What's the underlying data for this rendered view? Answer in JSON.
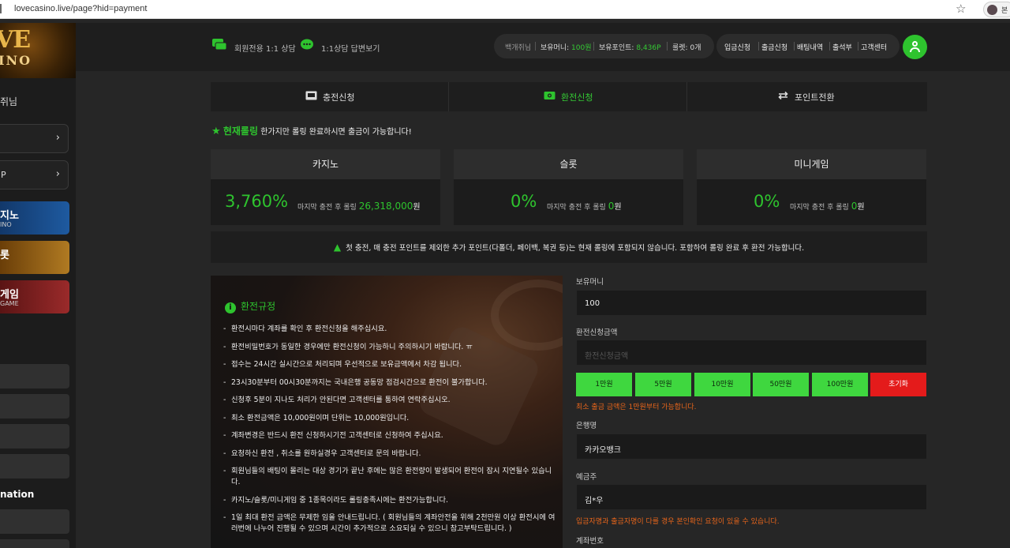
{
  "browser": {
    "url": "lovecasino.live/page?hid=payment",
    "profile_label": "본"
  },
  "logo": {
    "line1": "VE",
    "line2": "INO"
  },
  "sidebar": {
    "user": "쥐님",
    "buttons": [
      {
        "label": ""
      },
      {
        "label": "P"
      }
    ],
    "games": [
      {
        "title": "지노",
        "sub": "INO",
        "color": "#1d4f8a"
      },
      {
        "title": "롯",
        "sub": "",
        "color": "#9a6416"
      },
      {
        "title": "게임",
        "sub": "GAME",
        "color": "#8a2424"
      }
    ],
    "info_label": "nation"
  },
  "topbar": {
    "consult": "회원전용 1:1 상담",
    "answers": "1:1상담 답변보기",
    "stats": {
      "name": "백개쥐님",
      "money_label": "보유머니:",
      "money_value": "100원",
      "point_label": "보유포인트:",
      "point_value": "8,436P",
      "ticket_label": "룰렛:",
      "ticket_value": "0개"
    },
    "menu": [
      "입금신청",
      "출금신청",
      "배팅내역",
      "출석부",
      "고객센터"
    ]
  },
  "tabs": [
    {
      "label": "충전신청",
      "icon": "wallet-icon"
    },
    {
      "label": "환전신청",
      "icon": "cash-icon"
    },
    {
      "label": "포인트전환",
      "icon": "exchange-icon"
    }
  ],
  "rolling": {
    "title": "현재롤링",
    "desc": "한가지만 롤링 완료하시면 출금이 가능합니다!"
  },
  "cards": [
    {
      "title": "카지노",
      "pct": "3,760%",
      "sub": "마지막 충전 후 롤링",
      "amount": "26,318,000",
      "unit": "원"
    },
    {
      "title": "슬롯",
      "pct": "0%",
      "sub": "마지막 충전 후 롤링",
      "amount": "0",
      "unit": "원"
    },
    {
      "title": "미니게임",
      "pct": "0%",
      "sub": "마지막 충전 후 롤링",
      "amount": "0",
      "unit": "원"
    }
  ],
  "notice": "첫 충전, 매 충전 포인트를 제외한 추가 포인트(다폴더, 페이백, 복권 등)는 현재 롤링에 포함되지 않습니다. 포함하여 롤링 완료 후 환전 가능합니다.",
  "rules": {
    "title": "환전규정",
    "items": [
      "환전시마다 계좌를 확인 후 환전신청을 해주십시요.",
      "환전비밀번호가 동일한 경우에만 환전신청이 가능하니 주의하시기 바랍니다. ㅠ",
      "접수는 24시간 실시간으로 처리되며 우선적으로 보유금액에서 차감 됩니다.",
      "23시30분부터 00시30분까지는 국내은행 공동망 점검시간으로 환전이 불가합니다.",
      "신청후 5분이 지나도 처리가 안된다면 고객센터를 통하여 연락주십시오.",
      "최소 환전금액은 10,000원이며 단위는 10,000원입니다.",
      "계좌변경은 반드시 환전 신청하시기전 고객센터로 신청하여 주십시요.",
      "요청하신 환전 , 취소를 원하실경우 고객센터로 문의 바랍니다.",
      "회원님들의 배팅이 몰리는 대상 경기가 끝난 후에는 많은 환전량이 발생되어 환전이 잠시 지연될수 있습니다.",
      "카지노/슬롯/미니게임 중 1종목이라도 롤링충족시에는 환전가능합니다.",
      "1일 최대 환전 금액은 무제한 임을 안내드립니다. ( 회원님들의 계좌안전을 위해 2천만원 이상 환전시에 여러번에 나누어 진행될 수 있으며 시간이 추가적으로 소요되실 수 있으니 참고부탁드립니다. )"
    ]
  },
  "form": {
    "money_label": "보유머니",
    "money_value": "100",
    "amount_label": "환전신청금액",
    "amount_placeholder": "환전신청금액",
    "amount_buttons": [
      "1만원",
      "5만원",
      "10만원",
      "50만원",
      "100만원"
    ],
    "reset_label": "초기화",
    "min_notice": "최소 출금 금액은 1만원부터 가능합니다.",
    "bank_label": "은행명",
    "bank_value": "카카오뱅크",
    "holder_label": "예금주",
    "holder_value": "김*우",
    "holder_notice": "입금자명과 출금자명이 다를 경우 본인확인 요청이 있을 수 있습니다.",
    "account_label": "계좌번호"
  },
  "colors": {
    "accent": "#2ec32e",
    "danger": "#e41b1b",
    "warn": "#e8651b"
  }
}
